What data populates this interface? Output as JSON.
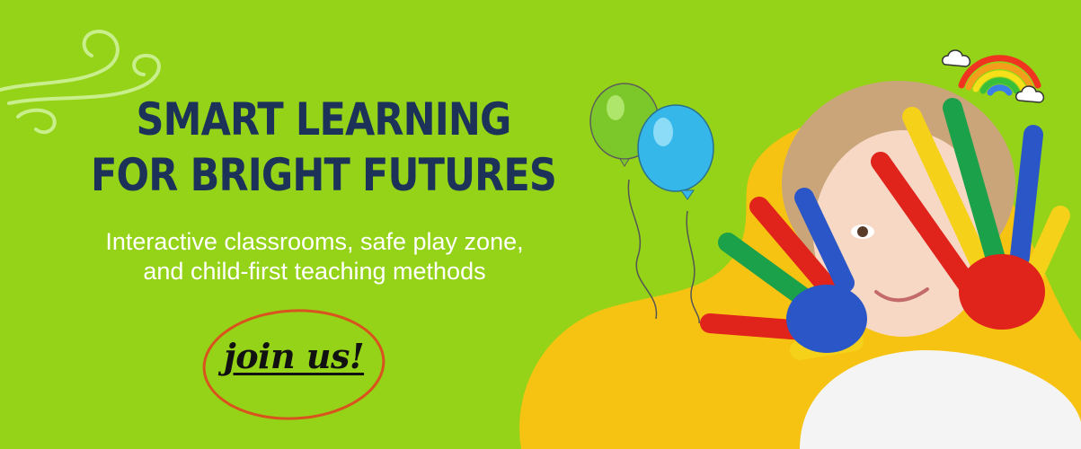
{
  "hero": {
    "headline_line1": "SMART LEARNING",
    "headline_line2": "FOR BRIGHT FUTURES",
    "subtitle_line1": "Interactive classrooms, safe play zone,",
    "subtitle_line2": "and child-first teaching methods",
    "cta_label": "join us!"
  },
  "colors": {
    "background": "#94d317",
    "headline": "#1d3258",
    "subtitle": "#ffffff",
    "cta_ring": "#d9531e",
    "blob": "#f7c313"
  },
  "decor": {
    "swirl": "wind-swirl-icon",
    "balloons": "balloons-icon",
    "rainbow": "rainbow-icon",
    "photo": "child-painted-hands-photo"
  }
}
